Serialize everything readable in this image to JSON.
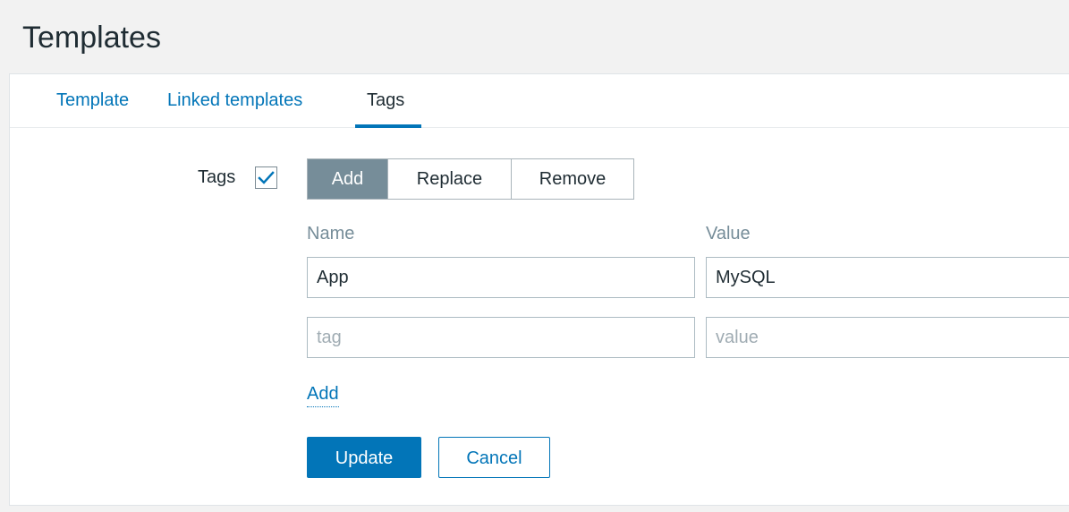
{
  "page": {
    "title": "Templates"
  },
  "tabs": [
    {
      "label": "Template",
      "active": false
    },
    {
      "label": "Linked templates",
      "active": false
    },
    {
      "label": "Tags",
      "active": true
    }
  ],
  "tags_field": {
    "label": "Tags",
    "checked": true,
    "modes": [
      {
        "label": "Add",
        "active": true
      },
      {
        "label": "Replace",
        "active": false
      },
      {
        "label": "Remove",
        "active": false
      }
    ],
    "columns": {
      "name": "Name",
      "value": "Value"
    },
    "rows": [
      {
        "name": "App",
        "value": "MySQL",
        "name_placeholder": "tag",
        "value_placeholder": "value"
      },
      {
        "name": "",
        "value": "",
        "name_placeholder": "tag",
        "value_placeholder": "value"
      }
    ],
    "add_link": "Add"
  },
  "actions": {
    "update_label": "Update",
    "cancel_label": "Cancel"
  },
  "colors": {
    "accent": "#0275b8",
    "segment_active": "#768d99",
    "background": "#f2f2f2",
    "text": "#1f2c33"
  },
  "icons": {
    "checkbox": "check-icon"
  }
}
